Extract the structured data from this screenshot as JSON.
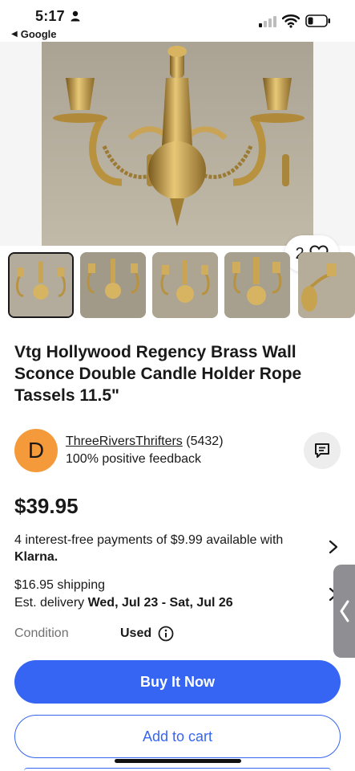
{
  "status_bar": {
    "time": "5:17",
    "back_app_label": "Google"
  },
  "hero": {
    "watch_count": "2"
  },
  "thumbnails": {
    "count_visible": 5,
    "selected_index": 0
  },
  "listing": {
    "title": "Vtg Hollywood Regency Brass Wall Sconce Double Candle Holder Rope Tassels 11.5\""
  },
  "seller": {
    "initial": "D",
    "name": "ThreeRiversThrifters",
    "rating_count": "(5432)",
    "feedback": "100% positive feedback"
  },
  "price": {
    "amount": "$39.95",
    "installments": "4 interest-free payments of $9.99 available with",
    "provider": "Klarna."
  },
  "shipping": {
    "cost": "$16.95 shipping",
    "delivery_prefix": "Est. delivery",
    "delivery_range": "Wed, Jul 23 - Sat, Jul 26"
  },
  "condition": {
    "label": "Condition",
    "value": "Used"
  },
  "actions": {
    "buy_now": "Buy It Now",
    "add_to_cart": "Add to cart"
  },
  "colors": {
    "accent": "#3665f3",
    "avatar": "#f59a3b",
    "text": "#191919",
    "muted": "#707070"
  }
}
